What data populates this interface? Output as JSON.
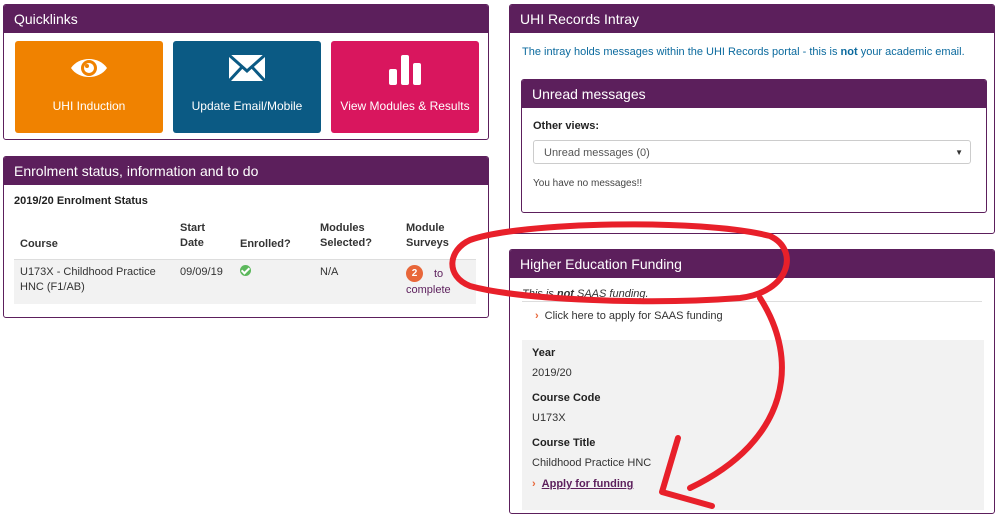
{
  "quicklinks": {
    "title": "Quicklinks",
    "tiles": [
      {
        "label": "UHI Induction",
        "icon": "eye-icon",
        "color": "#f08200"
      },
      {
        "label": "Update Email/Mobile",
        "icon": "envelope-icon",
        "color": "#0b5a84"
      },
      {
        "label": "View Modules & Results",
        "icon": "bar-chart-icon",
        "color": "#d9165e"
      }
    ]
  },
  "enrolment": {
    "title": "Enrolment status, information and to do",
    "subtitle": "2019/20 Enrolment Status",
    "headers": {
      "course": "Course",
      "start_1": "Start",
      "start_2": "Date",
      "enrolled": "Enrolled?",
      "modules_1": "Modules",
      "modules_2": "Selected?",
      "surveys_1": "Module",
      "surveys_2": "Surveys"
    },
    "row": {
      "course_1": "U173X - Childhood Practice",
      "course_2": "HNC (F1/AB)",
      "start": "09/09/19",
      "modules": "N/A",
      "survey_count": "2",
      "survey_to": "to",
      "survey_complete": "complete"
    }
  },
  "intray": {
    "title": "UHI Records Intray",
    "desc_before": "The intray holds messages within the UHI Records portal - this is ",
    "desc_bold": "not",
    "desc_after": " your academic email.",
    "unread": {
      "title": "Unread messages",
      "other_views": "Other views:",
      "selected": "Unread messages (0)",
      "empty": "You have no messages!!"
    }
  },
  "funding": {
    "title": "Higher Education Funding",
    "note_before": "This is ",
    "note_bold": "not",
    "note_after": " SAAS funding.",
    "saas_link": "Click here to apply for SAAS funding",
    "year_label": "Year",
    "year_value": "2019/20",
    "code_label": "Course Code",
    "code_value": "U173X",
    "course_title_label": "Course Title",
    "course_title_value": "Childhood Practice HNC",
    "apply_link": "Apply for funding"
  },
  "colors": {
    "header": "#5c1f5c",
    "annotation": "#e8202a"
  }
}
